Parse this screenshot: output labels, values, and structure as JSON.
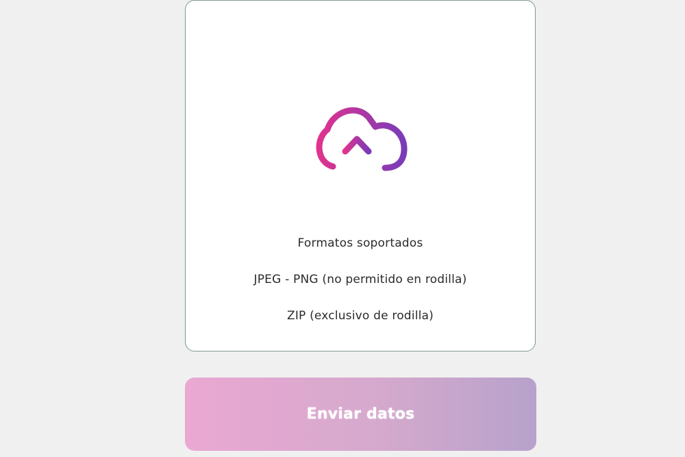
{
  "upload": {
    "icon": "cloud-upload-icon",
    "formats_title": "Formatos soportados",
    "formats": [
      "JPEG - PNG (no permitido en rodilla)",
      "ZIP (exclusivo de rodilla)"
    ]
  },
  "submit": {
    "label": "Enviar datos"
  },
  "colors": {
    "icon_gradient_start": "#e0338f",
    "icon_gradient_end": "#7a3bb8",
    "button_gradient_start": "#eaa8d2",
    "button_gradient_end": "#b7a2cb",
    "border": "#7e9a8b"
  }
}
